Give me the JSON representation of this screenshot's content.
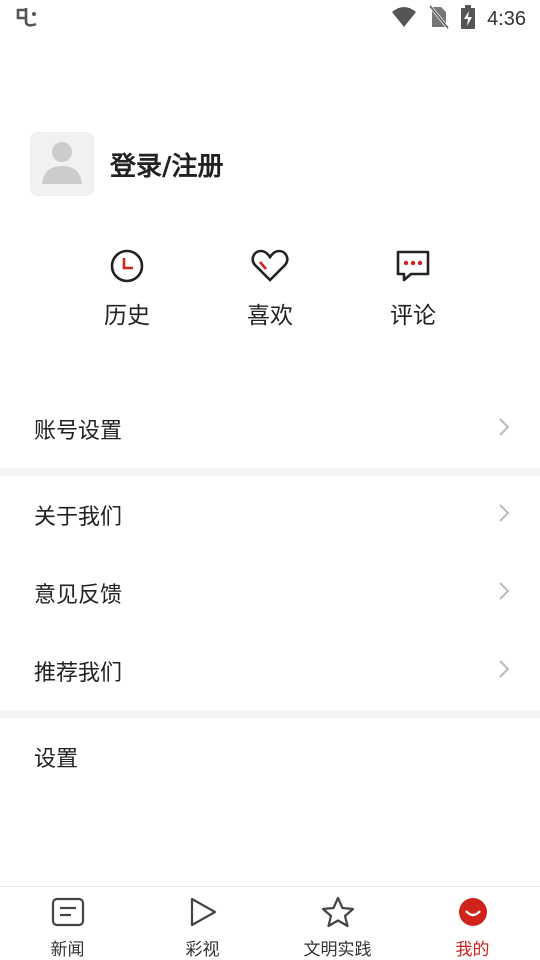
{
  "status_bar": {
    "time": "4:36",
    "icons": [
      "app-notification-icon",
      "wifi-icon",
      "no-sim-icon",
      "battery-charging-icon"
    ]
  },
  "profile": {
    "login_label": "登录/注册"
  },
  "quick_actions": [
    {
      "label": "历史",
      "icon": "clock-icon"
    },
    {
      "label": "喜欢",
      "icon": "heart-icon"
    },
    {
      "label": "评论",
      "icon": "comment-icon"
    }
  ],
  "menu": {
    "group1": [
      {
        "label": "账号设置"
      }
    ],
    "group2": [
      {
        "label": "关于我们"
      },
      {
        "label": "意见反馈"
      },
      {
        "label": "推荐我们"
      }
    ],
    "group3": [
      {
        "label": "设置"
      }
    ]
  },
  "tabbar": {
    "tabs": [
      {
        "label": "新闻",
        "icon": "news-icon"
      },
      {
        "label": "彩视",
        "icon": "play-icon"
      },
      {
        "label": "文明实践",
        "icon": "star-icon"
      },
      {
        "label": "我的",
        "icon": "profile-face-icon",
        "active": true
      }
    ]
  },
  "colors": {
    "accent": "#d0231c",
    "divider": "#f4f4f4",
    "text": "#222222"
  }
}
